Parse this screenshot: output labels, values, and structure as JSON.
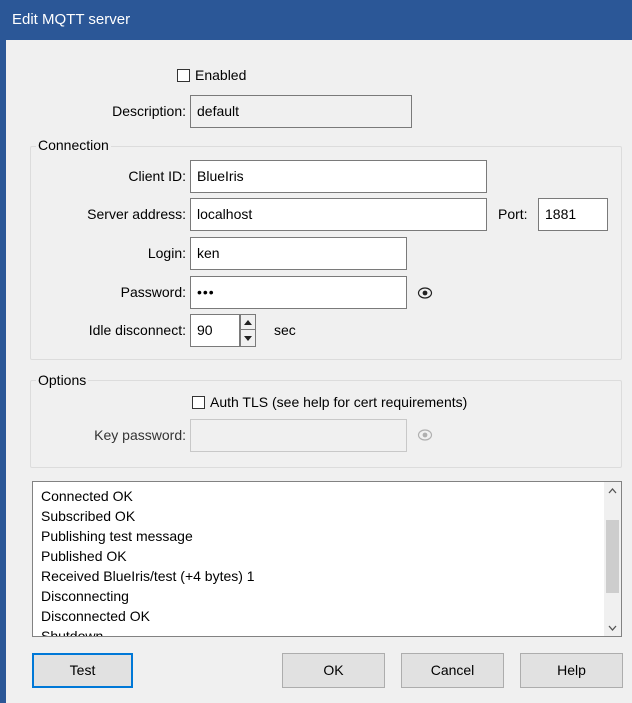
{
  "window": {
    "title": "Edit MQTT server"
  },
  "general": {
    "enabled_label": "Enabled",
    "enabled_checked": false,
    "description_label": "Description:",
    "description_value": "default"
  },
  "connection": {
    "group_title": "Connection",
    "client_id_label": "Client ID:",
    "client_id_value": "BlueIris",
    "server_address_label": "Server address:",
    "server_address_value": "localhost",
    "port_label": "Port:",
    "port_value": "1881",
    "login_label": "Login:",
    "login_value": "ken",
    "password_label": "Password:",
    "password_value": "•••",
    "idle_disconnect_label": "Idle disconnect:",
    "idle_disconnect_value": "90",
    "idle_disconnect_unit": "sec"
  },
  "options": {
    "group_title": "Options",
    "auth_tls_label": "Auth TLS (see help for cert requirements)",
    "auth_tls_checked": false,
    "key_password_label": "Key password:",
    "key_password_value": ""
  },
  "log": {
    "lines": [
      "Connected OK",
      "Subscribed OK",
      "Publishing test message",
      "Published OK",
      "Received BlueIris/test (+4 bytes) 1",
      "Disconnecting",
      "Disconnected OK",
      "Shutdown"
    ]
  },
  "buttons": {
    "test": "Test",
    "ok": "OK",
    "cancel": "Cancel",
    "help": "Help"
  },
  "colors": {
    "titlebar": "#2b5797",
    "default_button_border": "#0078d7"
  },
  "icons": {
    "show_password": "eye-icon",
    "spin_up": "chevron-up-icon",
    "spin_down": "chevron-down-icon",
    "scroll_up": "chevron-up-icon",
    "scroll_down": "chevron-down-icon"
  }
}
